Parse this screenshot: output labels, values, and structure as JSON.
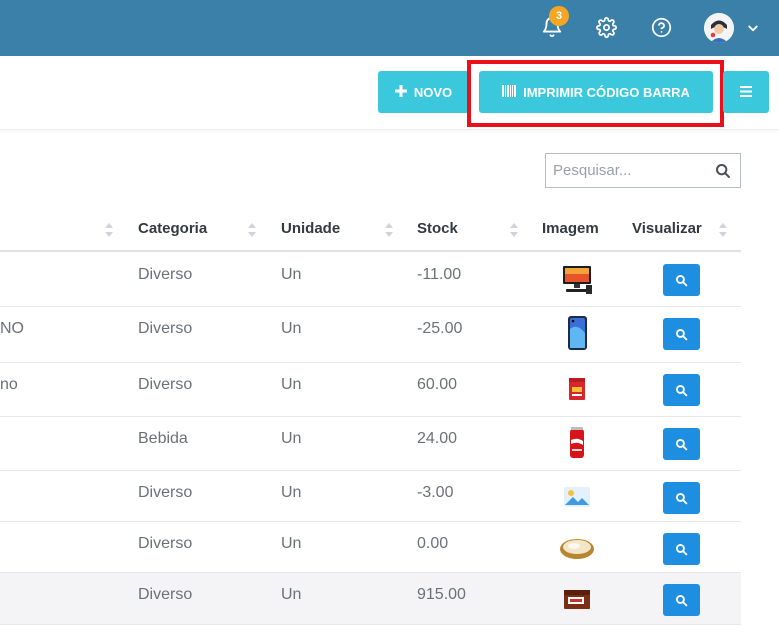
{
  "header": {
    "notification_count": "3",
    "icons": [
      "bell-icon",
      "gear-icon",
      "help-circle-icon",
      "avatar",
      "chevron-down-icon"
    ],
    "bg_color": "#3a80a8"
  },
  "toolbar": {
    "novo_label": "NOVO",
    "print_label": "IMPRIMIR CÓDIGO BARRA",
    "accent": "#3bc8dc",
    "highlight_color": "#e8101a"
  },
  "search": {
    "placeholder": "Pesquisar..."
  },
  "table": {
    "columns": {
      "categoria": "Categoria",
      "unidade": "Unidade",
      "stock": "Stock",
      "imagem": "Imagem",
      "visualizar": "Visualizar"
    },
    "rows": [
      {
        "name_fragment": "",
        "categoria": "Diverso",
        "unidade": "Un",
        "stock": "-11.00",
        "image": "computer-product-image"
      },
      {
        "name_fragment": "NO",
        "categoria": "Diverso",
        "unidade": "Un",
        "stock": "-25.00",
        "image": "smartphone-product-image"
      },
      {
        "name_fragment": "no",
        "categoria": "Diverso",
        "unidade": "Un",
        "stock": "60.00",
        "image": "food-package-product-image"
      },
      {
        "name_fragment": "",
        "categoria": "Bebida",
        "unidade": "Un",
        "stock": "24.00",
        "image": "cola-can-product-image"
      },
      {
        "name_fragment": "",
        "categoria": "Diverso",
        "unidade": "Un",
        "stock": "-3.00",
        "image": "placeholder-image-icon"
      },
      {
        "name_fragment": "",
        "categoria": "Diverso",
        "unidade": "Un",
        "stock": "0.00",
        "image": "pie-product-image"
      },
      {
        "name_fragment": "",
        "categoria": "Diverso",
        "unidade": "Un",
        "stock": "915.00",
        "image": "wafer-box-product-image"
      }
    ],
    "view_button_color": "#1e8fe0"
  }
}
